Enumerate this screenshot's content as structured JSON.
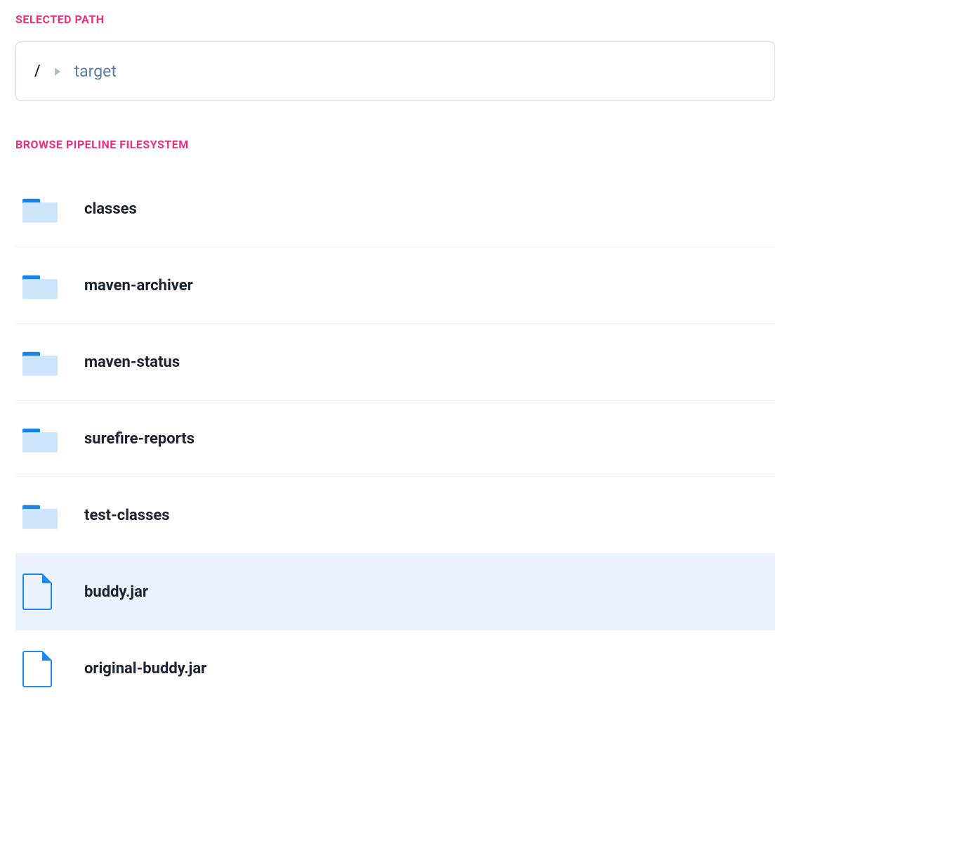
{
  "sections": {
    "selected_path_label": "Selected Path",
    "browse_label": "Browse Pipeline Filesystem"
  },
  "path": {
    "root": "/",
    "current": "target"
  },
  "entries": [
    {
      "name": "classes",
      "type": "folder",
      "selected": false
    },
    {
      "name": "maven-archiver",
      "type": "folder",
      "selected": false
    },
    {
      "name": "maven-status",
      "type": "folder",
      "selected": false
    },
    {
      "name": "surefire-reports",
      "type": "folder",
      "selected": false
    },
    {
      "name": "test-classes",
      "type": "folder",
      "selected": false
    },
    {
      "name": "buddy.jar",
      "type": "file",
      "selected": true
    },
    {
      "name": "original-buddy.jar",
      "type": "file",
      "selected": false
    }
  ]
}
